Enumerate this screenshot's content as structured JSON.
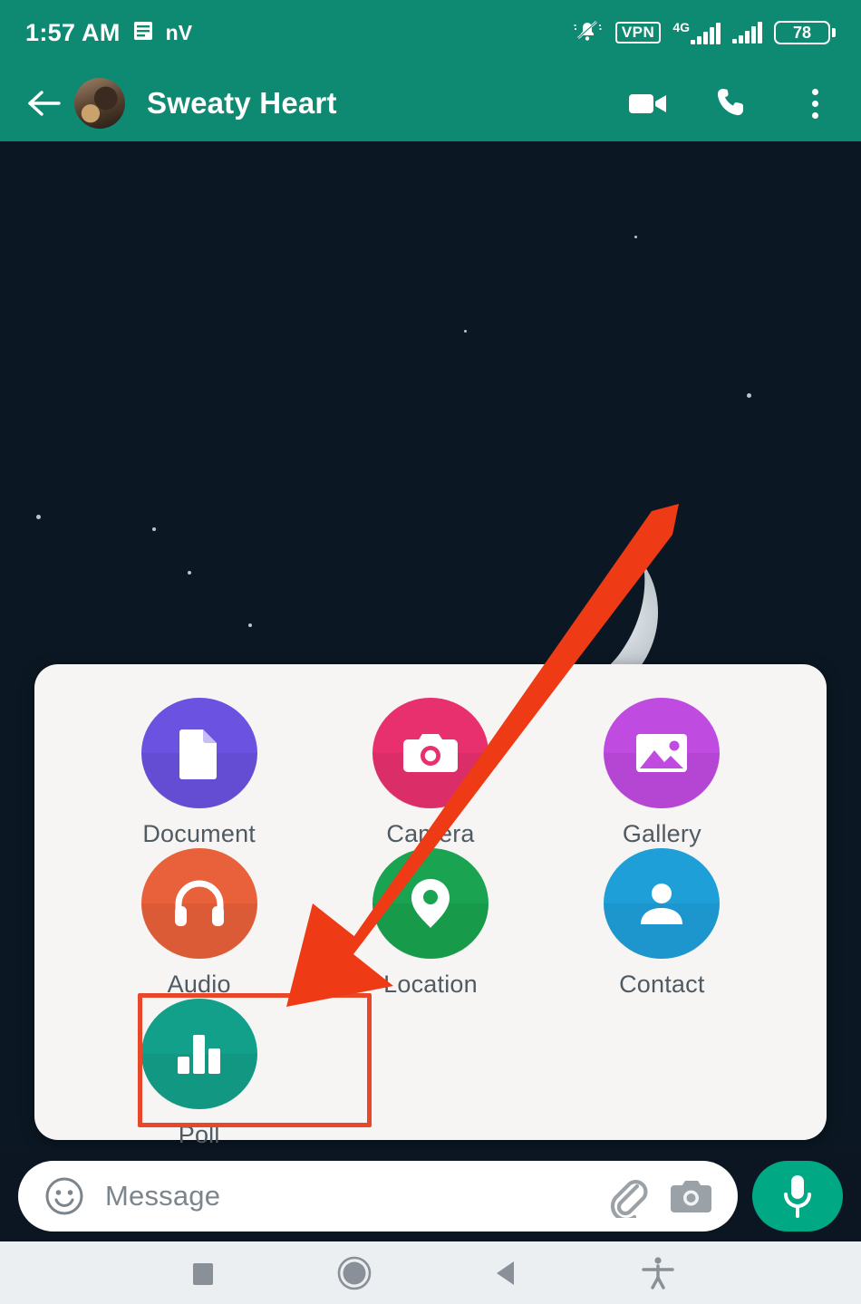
{
  "status_bar": {
    "time": "1:57 AM",
    "notification_icon": "notification-list-icon",
    "carrier_label": "nV",
    "mute_icon": "bell-muted-icon",
    "vpn_label": "VPN",
    "network_type": "4G",
    "signal_icon_1": "signal-bars-icon",
    "signal_icon_2": "signal-bars-icon",
    "battery_level": "78",
    "background_color": "#0f8a72"
  },
  "header": {
    "back_icon": "back-arrow-icon",
    "avatar": "contact-avatar",
    "title": "Sweaty Heart",
    "video_call_icon": "video-camera-icon",
    "voice_call_icon": "phone-icon",
    "overflow_icon": "more-options-icon",
    "background_color": "#0f8a72"
  },
  "wallpaper": {
    "description_icon": "crescent-moon-image",
    "background_color": "#0b1722"
  },
  "attach_panel": {
    "background_color": "#f6f5f3",
    "items": [
      {
        "label": "Document",
        "icon": "document-icon",
        "color": "#6b52e0"
      },
      {
        "label": "Camera",
        "icon": "camera-icon",
        "color": "#e8306e"
      },
      {
        "label": "Gallery",
        "icon": "gallery-icon",
        "color": "#c04be0"
      },
      {
        "label": "Audio",
        "icon": "headphones-icon",
        "color": "#e8613a"
      },
      {
        "label": "Location",
        "icon": "map-pin-icon",
        "color": "#1aa350"
      },
      {
        "label": "Contact",
        "icon": "person-icon",
        "color": "#1e9fd8"
      },
      {
        "label": "Poll",
        "icon": "bar-chart-icon",
        "color": "#12a08a"
      }
    ]
  },
  "annotation": {
    "arrow_icon": "red-pointer-arrow",
    "highlight_icon": "red-highlight-box",
    "color": "#ee3b16",
    "target_label": "Poll"
  },
  "input_bar": {
    "emoji_icon": "emoji-smiley-icon",
    "placeholder": "Message",
    "value": "",
    "attach_icon": "paperclip-icon",
    "camera_icon": "camera-icon",
    "mic_icon": "microphone-icon",
    "mic_color": "#00a884"
  },
  "nav_bar": {
    "recents_icon": "recents-square-icon",
    "home_icon": "home-circle-icon",
    "back_icon": "back-triangle-icon",
    "accessibility_icon": "accessibility-person-icon",
    "background_color": "#eceff1"
  }
}
